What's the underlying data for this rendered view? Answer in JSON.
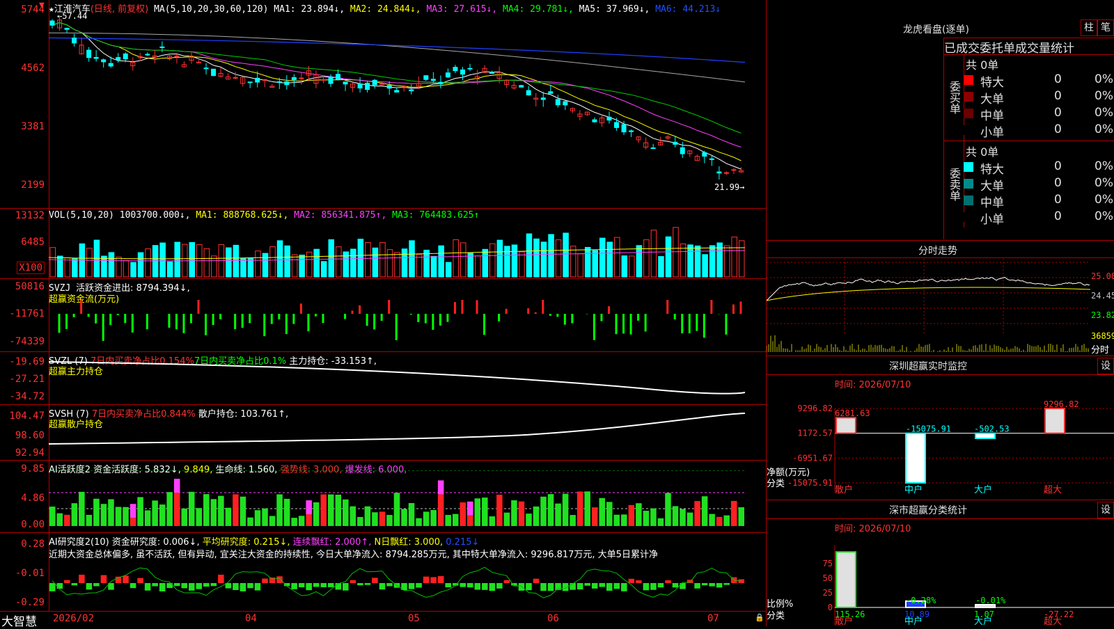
{
  "stock": {
    "name": "江淮汽车",
    "mode": "(日线, 前复权)",
    "mark": "★"
  },
  "ma_header": {
    "label": "MA(5,10,20,30,60,120)",
    "ma1": "MA1: 23.894↓,",
    "ma2": "MA2: 24.844↓,",
    "ma3": "MA3: 27.615↓,",
    "ma4": "MA4: 29.781↓,",
    "ma5": "MA5: 37.969↓,",
    "ma6": "MA6: 44.213↓"
  },
  "price_axis": [
    "5744",
    "4562",
    "3381",
    "2199"
  ],
  "price_high": "57.44",
  "price_low": "21.99",
  "vol_header": {
    "label": "VOL(5,10,20)",
    "value": "1003700.000↓,",
    "ma1": "MA1: 888768.625↓,",
    "ma2": "MA2: 856341.875↑,",
    "ma3": "MA3: 764483.625↑"
  },
  "vol_axis": [
    "13132",
    "6485",
    "X100"
  ],
  "svzj_header": {
    "label": "SVZJ",
    "text": "活跃资金进出: 8794.394↓,",
    "sub": "超赢资金流(万元)"
  },
  "svzj_axis": [
    "50816",
    "-11761",
    "-74339"
  ],
  "svzl_header": {
    "label": "SVZL (7)",
    "a": "7日内买卖净占比0.154%",
    "b": "7日内买卖净占比0.1%",
    "c": "主力持仓: -33.153↑,",
    "sub": "超赢主力持仓"
  },
  "svzl_axis": [
    "-19.69",
    "-27.21",
    "-34.72"
  ],
  "svsh_header": {
    "label": "SVSH (7)",
    "a": "7日内买卖净占比0.844%",
    "c": "散户持仓: 103.761↑,",
    "sub": "超赢散户持仓"
  },
  "svsh_axis": [
    "104.47",
    "98.60",
    "92.94"
  ],
  "ai1_header": {
    "label": "AI活跃度2",
    "a": "资金活跃度: 5.832↓,",
    "b": "9.849,",
    "c": "生命线: 1.560,",
    "d": "强势线: 3.000,",
    "e": "爆发线: 6.000,"
  },
  "ai1_axis": [
    "9.85",
    "4.86",
    "0.00"
  ],
  "ai2_header": {
    "label": "AI研究度2(10)",
    "a": "资金研究度: 0.006↓,",
    "b": "平均研究度: 0.215↓,",
    "c": "连续飘红: 2.000↑,",
    "d": "N日飘红: 3.000,",
    "e": "0.215↓"
  },
  "ai2_comment": "近期大资金总体偏多, 虽不活跃, 但有异动, 宜关注大资金的持续性, 今日大单净流入: 8794.285万元, 其中特大单净流入: 9296.817万元, 大单5日累计净",
  "ai2_axis": [
    "0.28",
    "-0.01",
    "-0.29"
  ],
  "date_axis": [
    "2026/02",
    "04",
    "05",
    "06",
    "07"
  ],
  "footer_brand": "大智慧",
  "right_top": {
    "title": "龙虎看盘(逐单)",
    "btn_a": "柱",
    "btn_b": "笔",
    "subtitle": "已成交委托单成交量统计",
    "buy_label": "委买单",
    "sell_label": "委卖单",
    "buy_total": "共 0单",
    "sell_total": "共 0单",
    "buy_rows": [
      {
        "name": "特大",
        "val": "0",
        "pct": "0%",
        "color": "#ff0000"
      },
      {
        "name": "大单",
        "val": "0",
        "pct": "0%",
        "color": "#8b0000"
      },
      {
        "name": "中单",
        "val": "0",
        "pct": "0%",
        "color": "#6b0000"
      },
      {
        "name": "小单",
        "val": "0",
        "pct": "0%",
        "color": "#000000"
      }
    ],
    "sell_rows": [
      {
        "name": "特大",
        "val": "0",
        "pct": "0%",
        "color": "#00ffff"
      },
      {
        "name": "大单",
        "val": "0",
        "pct": "0%",
        "color": "#008b8b"
      },
      {
        "name": "中单",
        "val": "0",
        "pct": "0%",
        "color": "#007070"
      },
      {
        "name": "小单",
        "val": "0",
        "pct": "0%",
        "color": "#000000"
      }
    ]
  },
  "intraday": {
    "title": "分时走势",
    "axis": [
      "25.08",
      "24.45",
      "23.82",
      "36859"
    ],
    "tail": "分时"
  },
  "monitor": {
    "title": "深圳超赢实时监控",
    "btn": "设",
    "time": "时间: 2026/07/10",
    "axis": [
      "9296.82",
      "1172.57",
      "-6951.67",
      "-15075.91"
    ],
    "ylabel": "净额(万元)",
    "xlabel": "分类",
    "cats": [
      "散户",
      "中户",
      "大户",
      "超大"
    ],
    "values": [
      6281.63,
      -15075.91,
      -502.53,
      9296.82
    ],
    "labels": [
      "6281.63",
      "-15075.91",
      "-502.53",
      "9296.82"
    ]
  },
  "classify": {
    "title": "深市超赢分类统计",
    "btn": "设",
    "time": "时间: 2026/07/10",
    "axis": [
      "75",
      "50",
      "25",
      "0"
    ],
    "ylabel": "比例%",
    "xlabel": "分类",
    "cats": [
      "散户",
      "中户",
      "大户",
      "超大"
    ],
    "pct": [
      115.26,
      10.89,
      1.07,
      -27.22
    ],
    "pct_labels": [
      "115.26",
      "10.89",
      "1.07",
      "-27.22"
    ],
    "small_labels": [
      "",
      "-0.28%",
      "-0.01%",
      ""
    ]
  }
}
